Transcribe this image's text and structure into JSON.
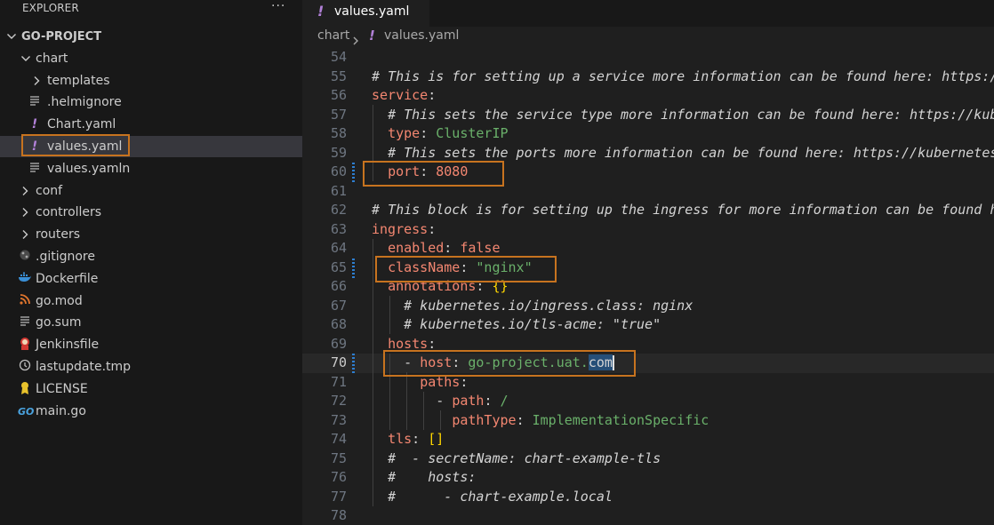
{
  "explorer": {
    "title": "EXPLORER",
    "more": "···",
    "project": "GO-PROJECT",
    "items": [
      {
        "label": "chart",
        "kind": "folder-open",
        "indent": 1
      },
      {
        "label": "templates",
        "kind": "folder",
        "indent": 2
      },
      {
        "label": ".helmignore",
        "kind": "lines",
        "indent": 2
      },
      {
        "label": "Chart.yaml",
        "kind": "yaml",
        "indent": 2
      },
      {
        "label": "values.yaml",
        "kind": "yaml",
        "indent": 2,
        "selected": true
      },
      {
        "label": "values.yamln",
        "kind": "lines",
        "indent": 2
      },
      {
        "label": "conf",
        "kind": "folder",
        "indent": 1
      },
      {
        "label": "controllers",
        "kind": "folder",
        "indent": 1
      },
      {
        "label": "routers",
        "kind": "folder",
        "indent": 1
      },
      {
        "label": ".gitignore",
        "kind": "git",
        "indent": 1
      },
      {
        "label": "Dockerfile",
        "kind": "docker",
        "indent": 1
      },
      {
        "label": "go.mod",
        "kind": "gomod",
        "indent": 1
      },
      {
        "label": "go.sum",
        "kind": "lines",
        "indent": 1
      },
      {
        "label": "Jenkinsfile",
        "kind": "jenkins",
        "indent": 1
      },
      {
        "label": "lastupdate.tmp",
        "kind": "clock",
        "indent": 1
      },
      {
        "label": "LICENSE",
        "kind": "license",
        "indent": 1
      },
      {
        "label": "main.go",
        "kind": "go",
        "indent": 1
      }
    ]
  },
  "tab": {
    "icon": "!",
    "label": "values.yaml",
    "close": "×"
  },
  "breadcrumb": {
    "folder": "chart",
    "icon": "!",
    "file": "values.yaml"
  },
  "editor": {
    "current_line": 70,
    "lines": [
      {
        "n": "54",
        "tokens": []
      },
      {
        "n": "55",
        "tokens": [
          [
            "com",
            "# This is for setting up a service more information can be found here: https://kubernetes.io/docs/concepts/services-networking/service/"
          ]
        ]
      },
      {
        "n": "56",
        "tokens": [
          [
            "key",
            "service"
          ],
          [
            "punct",
            ":"
          ]
        ]
      },
      {
        "n": "57",
        "tokens": [
          [
            "punct",
            "  "
          ],
          [
            "com",
            "# This sets the service type more information can be found here: https://kubernetes.io/docs/concepts/services-networking/service/#publishing-services-service-types"
          ]
        ]
      },
      {
        "n": "58",
        "tokens": [
          [
            "punct",
            "  "
          ],
          [
            "key",
            "type"
          ],
          [
            "punct",
            ": "
          ],
          [
            "str",
            "ClusterIP"
          ]
        ]
      },
      {
        "n": "59",
        "tokens": [
          [
            "punct",
            "  "
          ],
          [
            "com",
            "# This sets the ports more information can be found here: https://kubernetes.io/docs/concepts/services-networking/service/#field-spec-ports"
          ]
        ]
      },
      {
        "n": "60",
        "tokens": [
          [
            "punct",
            "  "
          ],
          [
            "key",
            "port"
          ],
          [
            "punct",
            ": "
          ],
          [
            "bool",
            "8080"
          ]
        ]
      },
      {
        "n": "61",
        "tokens": []
      },
      {
        "n": "62",
        "tokens": [
          [
            "com",
            "# This block is for setting up the ingress for more information can be found here: https://kubernetes.io/docs/concepts/services-networking/ingress/"
          ]
        ]
      },
      {
        "n": "63",
        "tokens": [
          [
            "key",
            "ingress"
          ],
          [
            "punct",
            ":"
          ]
        ]
      },
      {
        "n": "64",
        "tokens": [
          [
            "punct",
            "  "
          ],
          [
            "key",
            "enabled"
          ],
          [
            "punct",
            ": "
          ],
          [
            "bool",
            "false"
          ]
        ]
      },
      {
        "n": "65",
        "tokens": [
          [
            "punct",
            "  "
          ],
          [
            "key",
            "className"
          ],
          [
            "punct",
            ": "
          ],
          [
            "str",
            "\"nginx\""
          ]
        ]
      },
      {
        "n": "66",
        "tokens": [
          [
            "punct",
            "  "
          ],
          [
            "key",
            "annotations"
          ],
          [
            "punct",
            ": "
          ],
          [
            "brk",
            "{}"
          ]
        ]
      },
      {
        "n": "67",
        "tokens": [
          [
            "punct",
            "    "
          ],
          [
            "com",
            "# kubernetes.io/ingress.class: nginx"
          ]
        ]
      },
      {
        "n": "68",
        "tokens": [
          [
            "punct",
            "    "
          ],
          [
            "com",
            "# kubernetes.io/tls-acme: \"true\""
          ]
        ]
      },
      {
        "n": "69",
        "tokens": [
          [
            "punct",
            "  "
          ],
          [
            "key",
            "hosts"
          ],
          [
            "punct",
            ":"
          ]
        ]
      },
      {
        "n": "70",
        "tokens": [
          [
            "punct",
            "    - "
          ],
          [
            "key",
            "host"
          ],
          [
            "punct",
            ": "
          ],
          [
            "str",
            "go-project.uat."
          ],
          [
            "sel",
            "com"
          ],
          [
            "cursor",
            ""
          ]
        ]
      },
      {
        "n": "71",
        "tokens": [
          [
            "punct",
            "      "
          ],
          [
            "key",
            "paths"
          ],
          [
            "punct",
            ":"
          ]
        ]
      },
      {
        "n": "72",
        "tokens": [
          [
            "punct",
            "        - "
          ],
          [
            "key",
            "path"
          ],
          [
            "punct",
            ": "
          ],
          [
            "str",
            "/"
          ]
        ]
      },
      {
        "n": "73",
        "tokens": [
          [
            "punct",
            "          "
          ],
          [
            "key",
            "pathType"
          ],
          [
            "punct",
            ": "
          ],
          [
            "str",
            "ImplementationSpecific"
          ]
        ]
      },
      {
        "n": "74",
        "tokens": [
          [
            "punct",
            "  "
          ],
          [
            "key",
            "tls"
          ],
          [
            "punct",
            ": "
          ],
          [
            "brk",
            "[]"
          ]
        ]
      },
      {
        "n": "75",
        "tokens": [
          [
            "punct",
            "  "
          ],
          [
            "com",
            "#  - secretName: chart-example-tls"
          ]
        ]
      },
      {
        "n": "76",
        "tokens": [
          [
            "punct",
            "  "
          ],
          [
            "com",
            "#    hosts:"
          ]
        ]
      },
      {
        "n": "77",
        "tokens": [
          [
            "punct",
            "  "
          ],
          [
            "com",
            "#      - chart-example.local"
          ]
        ]
      },
      {
        "n": "78",
        "tokens": []
      }
    ]
  },
  "colors": {
    "highlight_box": "#c7731f",
    "accent_icon": "#b180d7"
  }
}
